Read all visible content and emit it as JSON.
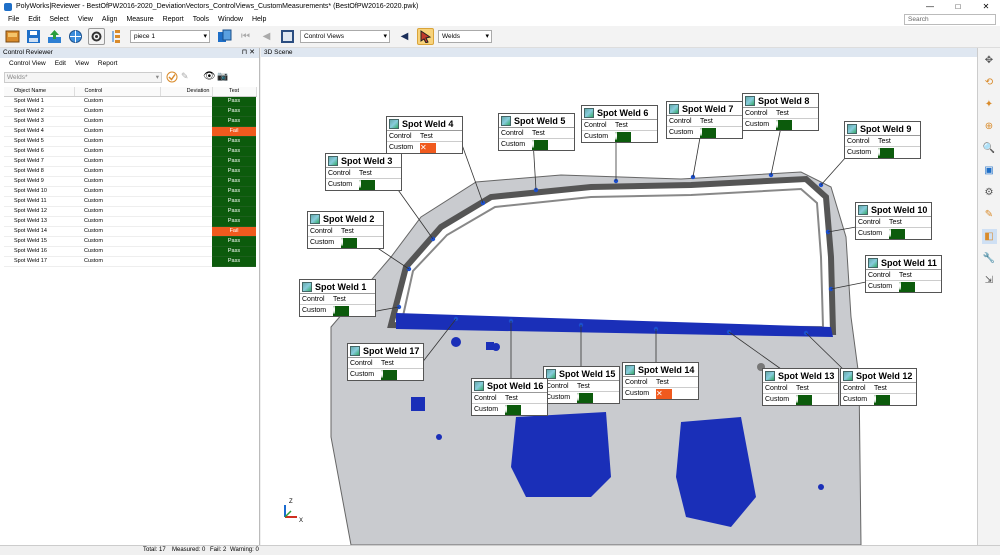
{
  "window": {
    "title": "PolyWorks|Reviewer - BestOfPW2016-2020_DeviationVectors_ControlViews_CustomMeasurements* (BestOfPW2016-2020.pwk)",
    "search_placeholder": "Search",
    "minimize": "—",
    "maximize": "□",
    "close": "✕"
  },
  "menu": [
    "File",
    "Edit",
    "Select",
    "View",
    "Align",
    "Measure",
    "Report",
    "Tools",
    "Window",
    "Help"
  ],
  "toolbar": {
    "piece_value": "piece 1",
    "control_views_value": "Control Views",
    "welds_value": "Welds"
  },
  "reviewer": {
    "title": "Control Reviewer",
    "pin": "⊓ ✕",
    "menu": [
      "Control View",
      "Edit",
      "View",
      "Report"
    ],
    "filter_value": "Welds*",
    "columns": [
      "Object Name",
      "Control",
      "Deviation",
      "Test"
    ],
    "rows": [
      {
        "name": "Spot Weld 1",
        "control": "Custom",
        "test": "Pass",
        "status": "pass"
      },
      {
        "name": "Spot Weld 2",
        "control": "Custom",
        "test": "Pass",
        "status": "pass"
      },
      {
        "name": "Spot Weld 3",
        "control": "Custom",
        "test": "Pass",
        "status": "pass"
      },
      {
        "name": "Spot Weld 4",
        "control": "Custom",
        "test": "Fail",
        "status": "fail"
      },
      {
        "name": "Spot Weld 5",
        "control": "Custom",
        "test": "Pass",
        "status": "pass"
      },
      {
        "name": "Spot Weld 6",
        "control": "Custom",
        "test": "Pass",
        "status": "pass"
      },
      {
        "name": "Spot Weld 7",
        "control": "Custom",
        "test": "Pass",
        "status": "pass"
      },
      {
        "name": "Spot Weld 8",
        "control": "Custom",
        "test": "Pass",
        "status": "pass"
      },
      {
        "name": "Spot Weld 9",
        "control": "Custom",
        "test": "Pass",
        "status": "pass"
      },
      {
        "name": "Spot Weld 10",
        "control": "Custom",
        "test": "Pass",
        "status": "pass"
      },
      {
        "name": "Spot Weld 11",
        "control": "Custom",
        "test": "Pass",
        "status": "pass"
      },
      {
        "name": "Spot Weld 12",
        "control": "Custom",
        "test": "Pass",
        "status": "pass"
      },
      {
        "name": "Spot Weld 13",
        "control": "Custom",
        "test": "Pass",
        "status": "pass"
      },
      {
        "name": "Spot Weld 14",
        "control": "Custom",
        "test": "Fail",
        "status": "fail"
      },
      {
        "name": "Spot Weld 15",
        "control": "Custom",
        "test": "Pass",
        "status": "pass"
      },
      {
        "name": "Spot Weld 16",
        "control": "Custom",
        "test": "Pass",
        "status": "pass"
      },
      {
        "name": "Spot Weld 17",
        "control": "Custom",
        "test": "Pass",
        "status": "pass"
      }
    ]
  },
  "status": {
    "total": "Total: 17",
    "measured": "Measured: 0",
    "fail": "Fail: 2",
    "warning": "Warning: 0"
  },
  "scene": {
    "title": "3D Scene",
    "axis_z": "Z",
    "axis_x": "X",
    "label_row_control": "Control",
    "label_row_test": "Test",
    "label_row_custom": "Custom",
    "labels": [
      {
        "title": "Spot Weld 1",
        "status": "pass"
      },
      {
        "title": "Spot Weld 2",
        "status": "pass"
      },
      {
        "title": "Spot Weld 3",
        "status": "pass"
      },
      {
        "title": "Spot Weld 4",
        "status": "fail"
      },
      {
        "title": "Spot Weld 5",
        "status": "pass"
      },
      {
        "title": "Spot Weld 6",
        "status": "pass"
      },
      {
        "title": "Spot Weld 7",
        "status": "pass"
      },
      {
        "title": "Spot Weld 8",
        "status": "pass"
      },
      {
        "title": "Spot Weld 9",
        "status": "pass"
      },
      {
        "title": "Spot Weld 10",
        "status": "pass"
      },
      {
        "title": "Spot Weld 11",
        "status": "pass"
      },
      {
        "title": "Spot Weld 12",
        "status": "pass"
      },
      {
        "title": "Spot Weld 13",
        "status": "pass"
      },
      {
        "title": "Spot Weld 14",
        "status": "fail"
      },
      {
        "title": "Spot Weld 15",
        "status": "pass"
      },
      {
        "title": "Spot Weld 16",
        "status": "pass"
      },
      {
        "title": "Spot Weld 17",
        "status": "pass"
      }
    ]
  },
  "colors": {
    "pass": "#0c5b0c",
    "fail": "#f05a1e",
    "part_blue": "#1a2fb8"
  }
}
